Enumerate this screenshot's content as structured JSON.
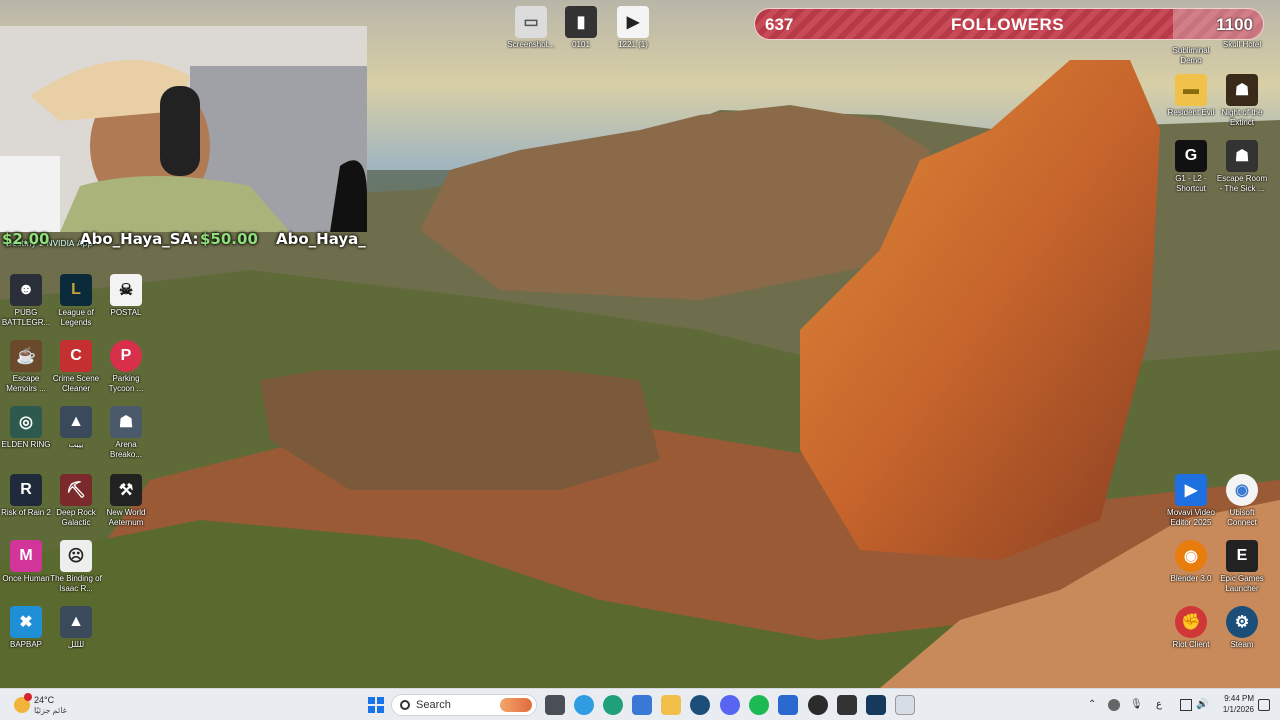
{
  "stream_overlay": {
    "donation_prefix": "$2.00",
    "donation_small": "Destiny 2 NVIDIA App",
    "donation_user": "Abo_Haya_SA:",
    "donation_amount": "$50.00",
    "donation_user_repeat": "Abo_Haya_"
  },
  "followers_bar": {
    "current": "637",
    "label": "FOLLOWERS",
    "goal": "1100"
  },
  "desktop_icons_left": [
    {
      "label": "PUBG BATTLEGR...",
      "icon": "pubg-icon",
      "color": "#2a2f3a",
      "glyph": "☻"
    },
    {
      "label": "League of Legends",
      "icon": "league-of-legends-icon",
      "color": "#0b2a3a",
      "glyph": "L"
    },
    {
      "label": "POSTAL",
      "icon": "postal-icon",
      "color": "#f3f3f3",
      "glyph": "☠"
    },
    {
      "label": "Escape Memoirs ...",
      "icon": "escape-memoirs-icon",
      "color": "#6a4a2a",
      "glyph": "☕"
    },
    {
      "label": "Crime Scene Cleaner",
      "icon": "crime-scene-cleaner-icon",
      "color": "#c62f2f",
      "glyph": "C"
    },
    {
      "label": "Parking Tycoon ...",
      "icon": "parking-tycoon-icon",
      "color": "#d8304a",
      "glyph": "P"
    },
    {
      "label": "ELDEN RING",
      "icon": "elden-ring-icon",
      "color": "#2e5a4e",
      "glyph": "◎"
    },
    {
      "label": "بيبب",
      "icon": "game-icon",
      "color": "#3a4a5a",
      "glyph": "▲"
    },
    {
      "label": "Arena Breako...",
      "icon": "arena-breakout-icon",
      "color": "#4a5a6a",
      "glyph": "☗"
    },
    {
      "label": "Risk of Rain 2",
      "icon": "risk-of-rain-icon",
      "color": "#1f2a3a",
      "glyph": "R"
    },
    {
      "label": "Deep Rock Galactic",
      "icon": "deep-rock-galactic-icon",
      "color": "#7a2a2a",
      "glyph": "⛏"
    },
    {
      "label": "New World Aeternum",
      "icon": "new-world-icon",
      "color": "#222",
      "glyph": "⚒"
    },
    {
      "label": "Once Human",
      "icon": "once-human-icon",
      "color": "#d2359a",
      "glyph": "M"
    },
    {
      "label": "The Binding of Isaac R...",
      "icon": "binding-of-isaac-icon",
      "color": "#eee",
      "glyph": "☹"
    },
    {
      "label": "BAPBAP",
      "icon": "bapbap-icon",
      "color": "#1f8fd6",
      "glyph": "✖"
    },
    {
      "label": "للللل",
      "icon": "game-icon",
      "color": "#3a4a5a",
      "glyph": "▲"
    }
  ],
  "desktop_icons_top": [
    {
      "label": "Screenshot...",
      "icon": "screenshot-file-icon",
      "color": "#dcdcdc",
      "glyph": "▭"
    },
    {
      "label": "0101",
      "icon": "phone-file-icon",
      "color": "#333",
      "glyph": "▮"
    },
    {
      "label": "1221 (1)",
      "icon": "video-file-icon",
      "color": "#f4f4f4",
      "glyph": "▶"
    },
    {
      "label": "Subliminal Demo",
      "icon": "subliminal-icon",
      "color": "#ccc",
      "glyph": "◆"
    },
    {
      "label": "Skull Hotel",
      "icon": "skull-hotel-icon",
      "color": "#222",
      "glyph": "☠"
    }
  ],
  "desktop_icons_right": [
    {
      "label": "Resident Evil",
      "icon": "folder-icon",
      "color": "#f0c24a",
      "glyph": "▬"
    },
    {
      "label": "Night of the Extinct",
      "icon": "night-of-extinct-icon",
      "color": "#3a2a1a",
      "glyph": "☗"
    },
    {
      "label": "G1 - L2 - Shortcut",
      "icon": "g-hub-icon",
      "color": "#111",
      "glyph": "G"
    },
    {
      "label": "Escape Room - The Sick ...",
      "icon": "escape-room-icon",
      "color": "#333",
      "glyph": "☗"
    },
    {
      "label": "Movavi Video Editor 2025",
      "icon": "movavi-icon",
      "color": "#1e6fe0",
      "glyph": "▶"
    },
    {
      "label": "Ubisoft Connect",
      "icon": "ubisoft-connect-icon",
      "color": "#f4f4f4",
      "glyph": "◉"
    },
    {
      "label": "Blender 3.0",
      "icon": "blender-icon",
      "color": "#e87d0d",
      "glyph": "◉"
    },
    {
      "label": "Epic Games Launcher",
      "icon": "epic-games-icon",
      "color": "#222",
      "glyph": "E"
    },
    {
      "label": "Riot Client",
      "icon": "riot-client-icon",
      "color": "#d13639",
      "glyph": "✊"
    },
    {
      "label": "Steam",
      "icon": "steam-icon",
      "color": "#1b4f7a",
      "glyph": "⚙"
    }
  ],
  "taskbar": {
    "weather_temp": "24°C",
    "weather_desc": "غائم جزئيًا",
    "search_placeholder": "Search",
    "time": "9:44 PM",
    "date": "1/1/2026",
    "lang": "ع"
  }
}
